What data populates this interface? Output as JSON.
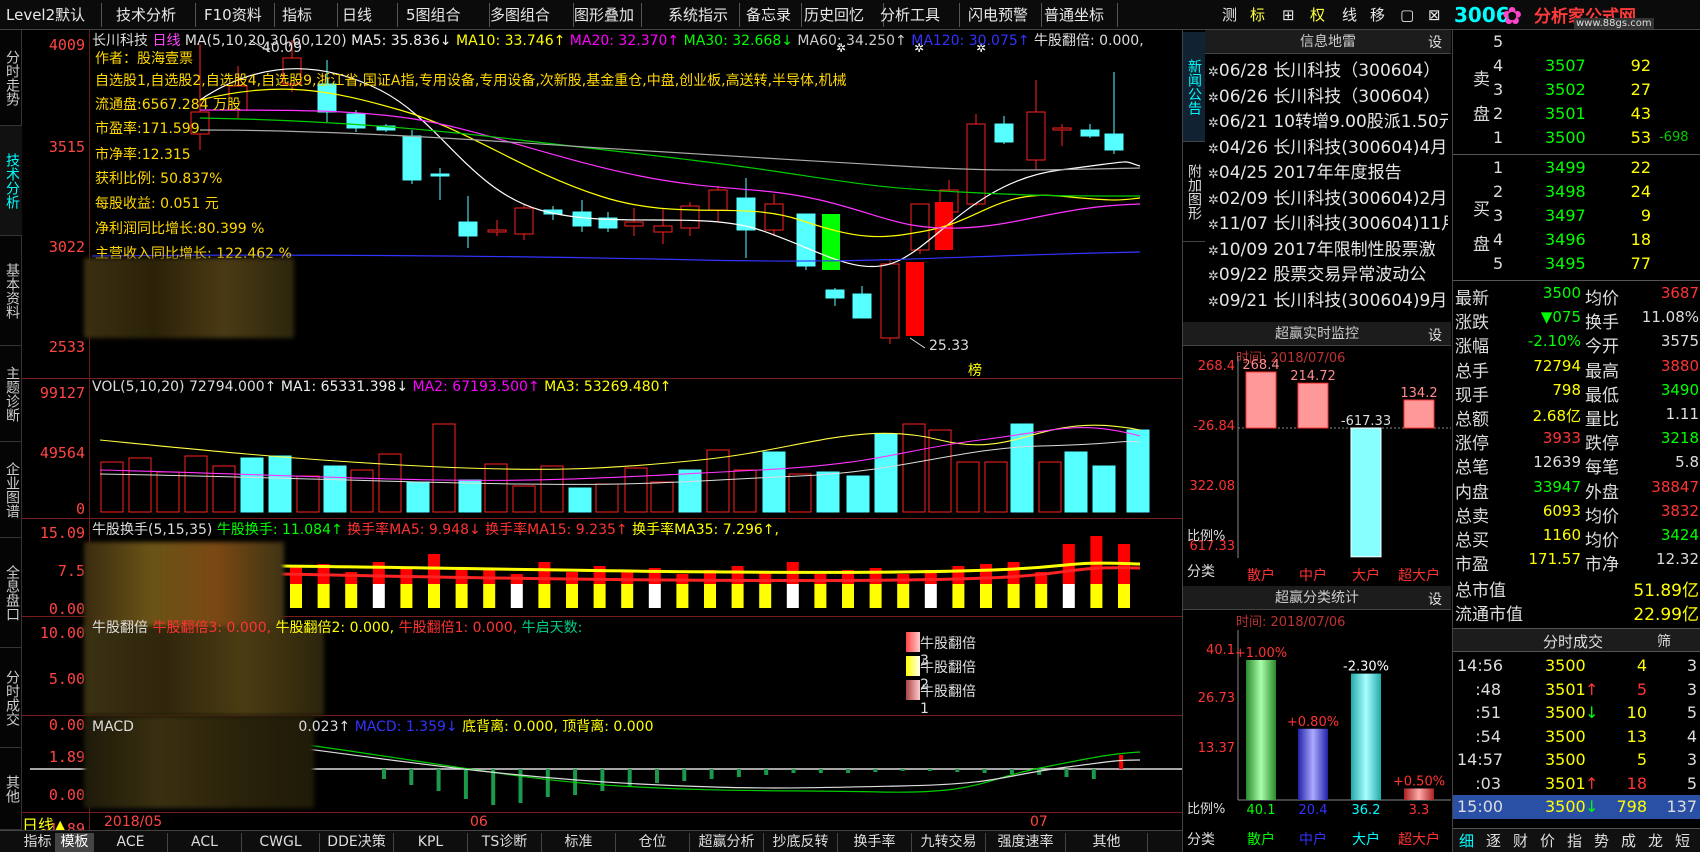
{
  "menubar": {
    "items": [
      "Level2默认",
      "技术分析",
      "F10资料",
      "指标",
      "日线",
      "5图组合",
      "多图组合",
      "图形叠加",
      "系统指示",
      "备忘录",
      "历史回忆",
      "分析工具",
      "闪电预警",
      "普通坐标"
    ],
    "right_tools": [
      "测",
      "标",
      "⊞",
      "权",
      "线",
      "移",
      "▢",
      "⊠"
    ],
    "code_partial": "3006"
  },
  "logo": {
    "text": "分析家公式网",
    "url": "www.88gs.com"
  },
  "left_tabs": [
    "分时走势",
    "技术分析",
    "基本资料",
    "主题诊断",
    "企业图谱",
    "全息盘口",
    "分时成交",
    "其他"
  ],
  "price_panel": {
    "y_labels": [
      "4009",
      "3515",
      "3022",
      "2533"
    ],
    "header": {
      "name": "长川科技",
      "period": "日线",
      "ma_params": "MA(5,10,20,30,60,120)",
      "ma5": "MA5: 35.836↓",
      "ma10": "MA10: 33.746↑",
      "ma20": "MA20: 32.370↑",
      "ma30": "MA30: 32.668↓",
      "ma60": "MA60: 34.250↑",
      "ma120": "MA120: 30.075↑",
      "fanbei": "牛股翻倍: 0.000,"
    },
    "info_lines": [
      "作者：股海壹票",
      "自选股1,自选股2,自选股4,自选股9,浙江省,国证A指,专用设备,专用设备,次新股,基金重仓,中盘,创业板,高送转,半导体,机械",
      "流通盘:6567.284  万股",
      "市盈率:171.599",
      "市净率:12.315",
      "获利比例: 50.837%",
      "每股收益: 0.051    元",
      "净利润同比增长:80.399   %",
      "主营收入同比增长: 122.462 %"
    ],
    "high_label": "40.09",
    "low_label": "25.33",
    "bang_label": "榜"
  },
  "vol_panel": {
    "y_labels": [
      "99127",
      "49564",
      "0"
    ],
    "header": {
      "title": "VOL(5,10,20)",
      "value": "72794.000↑",
      "ma1": "MA1: 65331.398↓",
      "ma2": "MA2: 67193.500↑",
      "ma3": "MA3: 53269.480↑"
    }
  },
  "turnover_panel": {
    "y_labels": [
      "15.09",
      "7.5",
      "0.00"
    ],
    "header": {
      "title": "牛股换手(5,15,35)",
      "v1": "牛股换手: 11.084↑",
      "v2": "换手率MA5: 9.948↓",
      "v3": "换手率MA15: 9.235↑",
      "v4": "换手率MA35: 7.296↑,"
    }
  },
  "fanbei_panel": {
    "y_labels": [
      "10.00",
      "5.00",
      "0.00"
    ],
    "header": {
      "title": "牛股翻倍",
      "v1": "牛股翻倍3: 0.000,",
      "v2": "牛股翻倍2: 0.000,",
      "v3": "牛股翻倍1: 0.000,",
      "v4": "牛启天数:"
    },
    "legend": [
      "牛股翻倍3",
      "牛股翻倍2",
      "牛股翻倍1"
    ]
  },
  "macd_panel": {
    "y_labels": [
      "1.89",
      "0.00",
      "-1.89"
    ],
    "header": {
      "title": "MACD",
      "v1": "0.023↑",
      "v2": "MACD: 1.359↓",
      "v3": "底背离: 0.000,",
      "v4": "顶背离: 0.000"
    }
  },
  "x_axis": {
    "period": "日线▲",
    "dates": [
      "2018/05",
      "06",
      "07"
    ]
  },
  "bottom_tabs": [
    "指标",
    "模板",
    "ACE",
    "ACL",
    "CWGL",
    "DDE决策",
    "KPL",
    "TS诊断",
    "标准",
    "仓位",
    "超赢分析",
    "抄底反转",
    "换手率",
    "九转交易",
    "强度速率",
    "其他"
  ],
  "side_tabs": [
    "新闻公告",
    "附加图形"
  ],
  "news": {
    "title": "信息地雷",
    "set": "设",
    "items": [
      {
        "date": "06/28",
        "text": "长川科技（300604）"
      },
      {
        "date": "06/26",
        "text": "长川科技（300604）"
      },
      {
        "date": "06/21",
        "text": "10转增9.00股派1.50元"
      },
      {
        "date": "04/26",
        "text": "长川科技(300604)4月"
      },
      {
        "date": "04/25",
        "text": "2017年年度报告"
      },
      {
        "date": "02/09",
        "text": "长川科技(300604)2月"
      },
      {
        "date": "11/07",
        "text": "长川科技(300604)11月"
      },
      {
        "date": "10/09",
        "text": "2017年限制性股票激"
      },
      {
        "date": "09/22",
        "text": "股票交易异常波动公"
      },
      {
        "date": "09/21",
        "text": "长川科技(300604)9月"
      }
    ]
  },
  "monitor": {
    "title": "超赢实时监控",
    "set": "设",
    "time": "时间: 2018/07/06",
    "y_labels": [
      "268.4",
      "-26.84",
      "322.08",
      "617.33"
    ],
    "bar_values": [
      "268.4",
      "214.72",
      "-617.33",
      "134.2"
    ],
    "bars": [
      268.4,
      214.72,
      -617.33,
      134.2
    ],
    "ratio_label": "比例%",
    "category_label": "分类",
    "categories": [
      "散户",
      "中户",
      "大户",
      "超大户"
    ]
  },
  "stats": {
    "title": "超赢分类统计",
    "set": "设",
    "time": "时间: 2018/07/06",
    "y_labels": [
      "40.1",
      "26.73",
      "13.37"
    ],
    "pct_labels": [
      "+1.00%",
      "+0.80%",
      "-2.30%",
      "+0.50%"
    ],
    "values": [
      40.1,
      20.4,
      36.2,
      3.3
    ],
    "value_labels": [
      "40.1",
      "20.4",
      "36.2",
      "3.3"
    ],
    "ratio_label": "比例%",
    "category_label": "分类",
    "categories": [
      "散户",
      "中户",
      "大户",
      "超大户"
    ]
  },
  "orderbook": {
    "sell_label": "卖盘",
    "buy_label": "买盘",
    "sell": [
      {
        "lvl": "5",
        "price": "",
        "vol": ""
      },
      {
        "lvl": "4",
        "price": "3507",
        "vol": "92"
      },
      {
        "lvl": "3",
        "price": "3502",
        "vol": "27"
      },
      {
        "lvl": "2",
        "price": "3501",
        "vol": "43"
      },
      {
        "lvl": "1",
        "price": "3500",
        "vol": "53",
        "extra": "-698"
      }
    ],
    "buy": [
      {
        "lvl": "1",
        "price": "3499",
        "vol": "22"
      },
      {
        "lvl": "2",
        "price": "3498",
        "vol": "24"
      },
      {
        "lvl": "3",
        "price": "3497",
        "vol": "9"
      },
      {
        "lvl": "4",
        "price": "3496",
        "vol": "18"
      },
      {
        "lvl": "5",
        "price": "3495",
        "vol": "77"
      }
    ]
  },
  "quote": [
    {
      "k1": "最新",
      "v1": "3500",
      "k2": "均价",
      "v2": "3687"
    },
    {
      "k1": "涨跌",
      "v1": "▼075",
      "k2": "换手",
      "v2": "11.08%"
    },
    {
      "k1": "涨幅",
      "v1": "-2.10%",
      "k2": "今开",
      "v2": "3575"
    },
    {
      "k1": "总手",
      "v1": "72794",
      "k2": "最高",
      "v2": "3880"
    },
    {
      "k1": "现手",
      "v1": "798",
      "k2": "最低",
      "v2": "3490"
    },
    {
      "k1": "总额",
      "v1": "2.68亿",
      "k2": "量比",
      "v2": "1.11"
    },
    {
      "k1": "涨停",
      "v1": "3933",
      "k2": "跌停",
      "v2": "3218"
    },
    {
      "k1": "总笔",
      "v1": "12639",
      "k2": "每笔",
      "v2": "5.8"
    },
    {
      "k1": "内盘",
      "v1": "33947",
      "k2": "外盘",
      "v2": "38847"
    },
    {
      "k1": "总卖",
      "v1": "6093",
      "k2": "均价",
      "v2": "3832"
    },
    {
      "k1": "总买",
      "v1": "1160",
      "k2": "均价",
      "v2": "3424"
    },
    {
      "k1": "市盈",
      "v1": "171.57",
      "k2": "市净",
      "v2": "12.32"
    }
  ],
  "caps": [
    {
      "k": "总市值",
      "v": "51.89亿"
    },
    {
      "k": "流通市值",
      "v": "22.99亿"
    }
  ],
  "ticks": {
    "title": "分时成交",
    "tool": "筛",
    "rows": [
      {
        "t": "14:56",
        "p": "3500",
        "arrow": "",
        "v": "4",
        "n": "3"
      },
      {
        "t": ":48",
        "p": "3501",
        "arrow": "↑",
        "v": "5",
        "n": "3"
      },
      {
        "t": ":51",
        "p": "3500",
        "arrow": "↓",
        "v": "10",
        "n": "5"
      },
      {
        "t": ":54",
        "p": "3500",
        "arrow": "",
        "v": "13",
        "n": "4"
      },
      {
        "t": "14:57",
        "p": "3500",
        "arrow": "",
        "v": "5",
        "n": "3"
      },
      {
        "t": ":03",
        "p": "3501",
        "arrow": "↑",
        "v": "18",
        "n": "5"
      },
      {
        "t": "15:00",
        "p": "3500",
        "arrow": "↓",
        "v": "798",
        "n": "137"
      }
    ]
  },
  "bottom_right_tabs": [
    "细",
    "逐",
    "财",
    "价",
    "指",
    "势",
    "成",
    "龙",
    "短"
  ]
}
